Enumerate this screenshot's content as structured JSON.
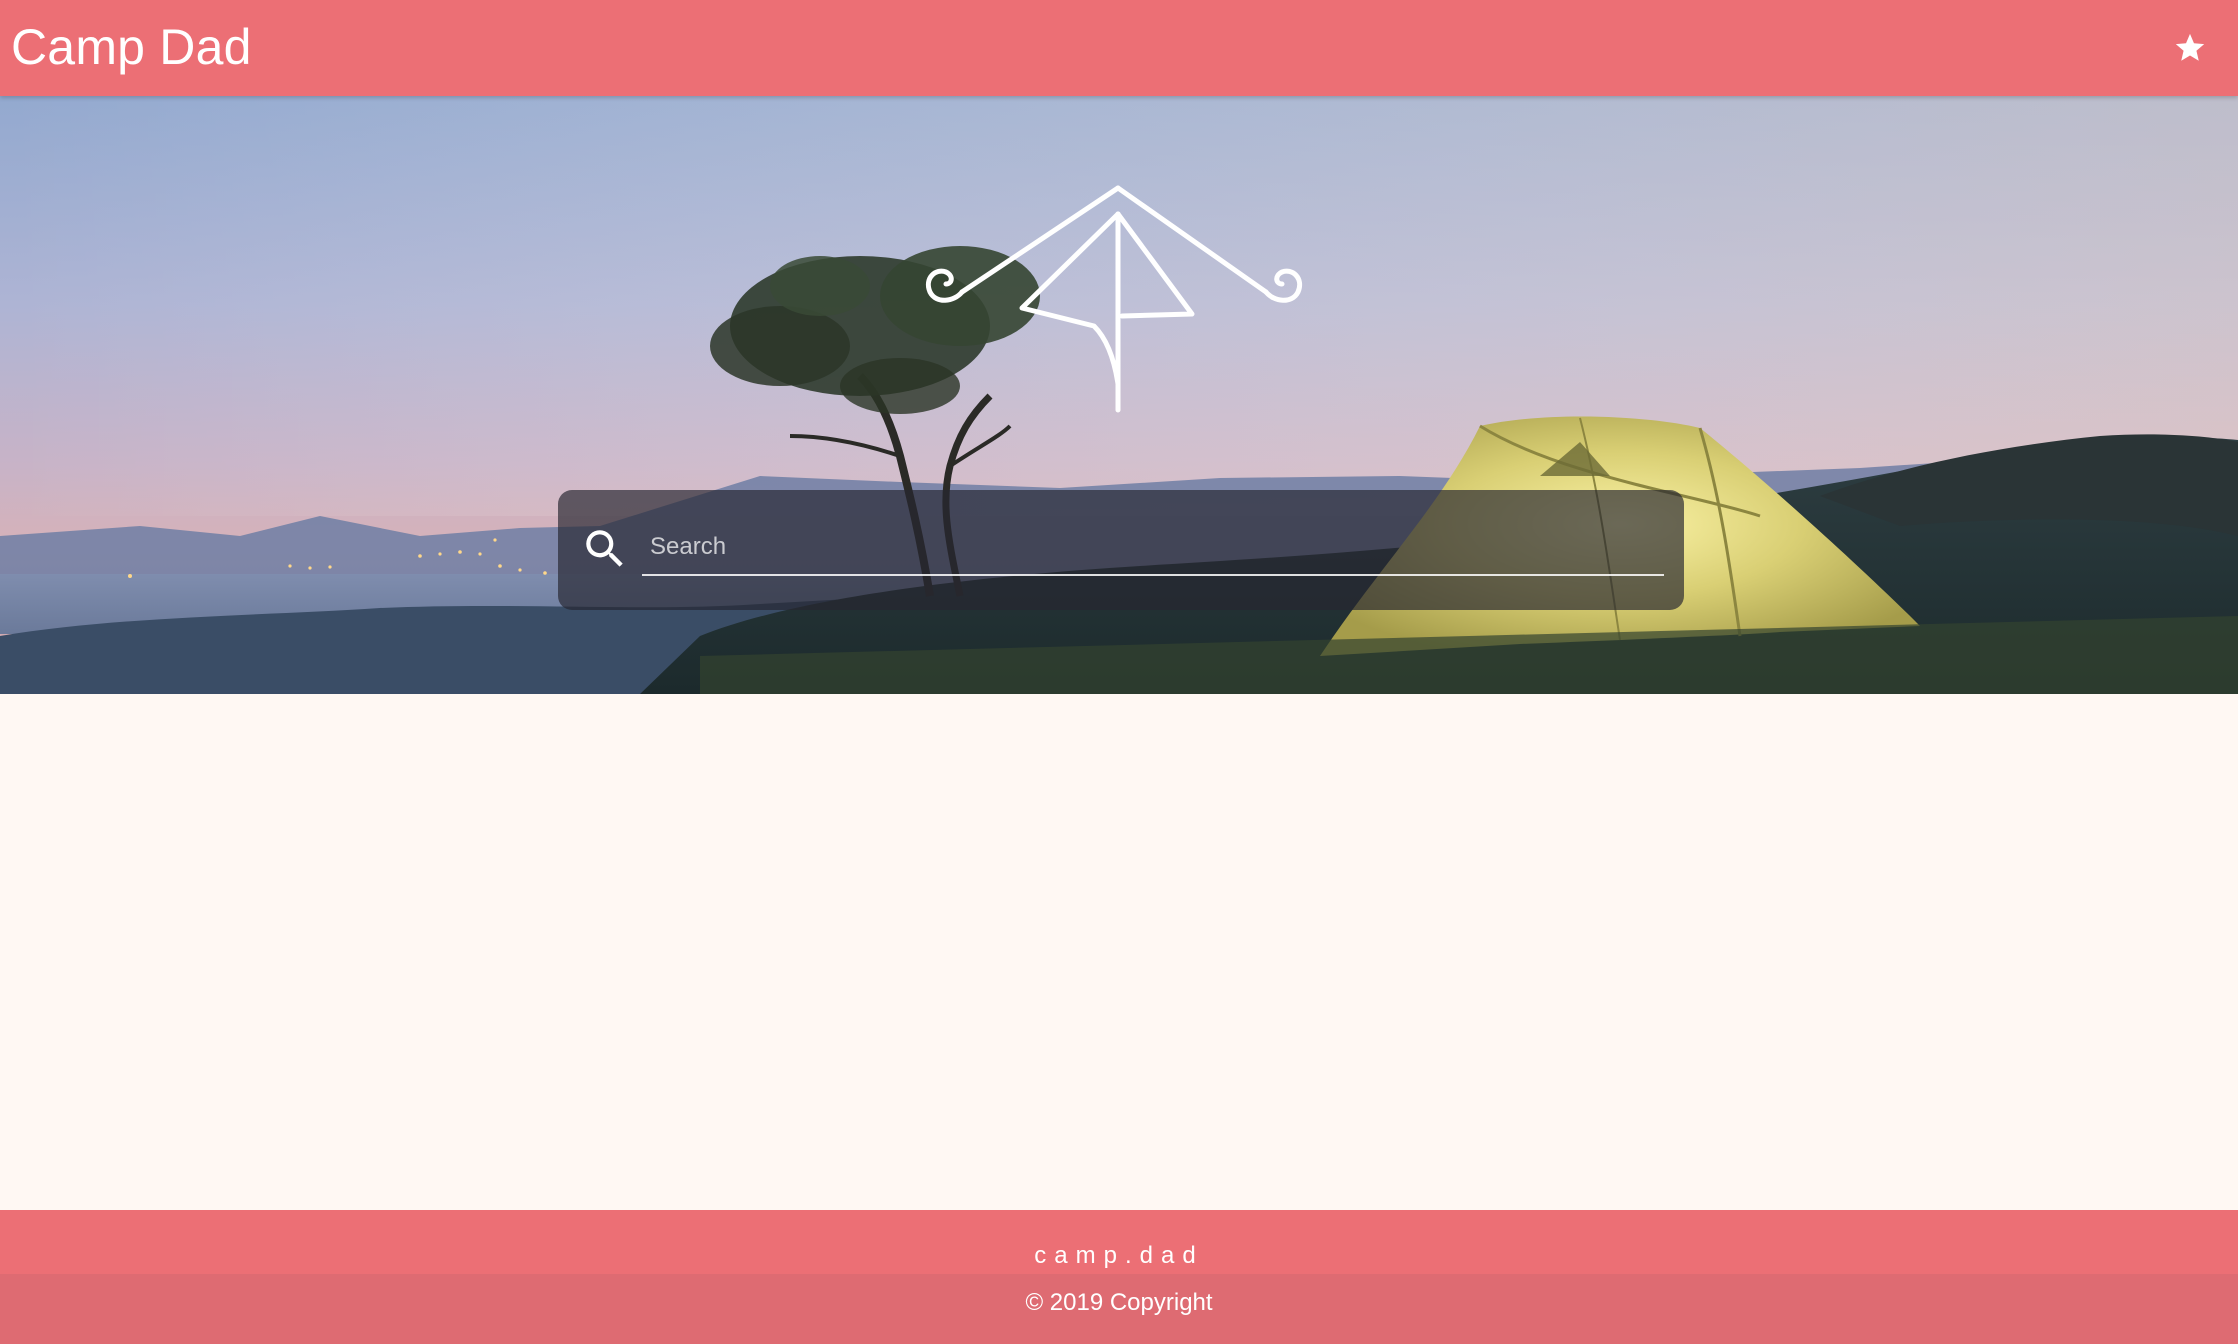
{
  "header": {
    "title": "Camp Dad",
    "favorite_icon": "star-icon"
  },
  "hero": {
    "background": "camping-tent-sunset-photo",
    "logo_icon": "tent-logo-icon"
  },
  "search": {
    "icon": "search-icon",
    "placeholder": "Search",
    "value": ""
  },
  "footer": {
    "brand": "camp.dad",
    "copyright": "© 2019 Copyright"
  },
  "colors": {
    "header": "#ec6f75",
    "footer_bottom": "#de6b72",
    "page_background": "#fff8f3",
    "search_bar": "#26262f"
  }
}
